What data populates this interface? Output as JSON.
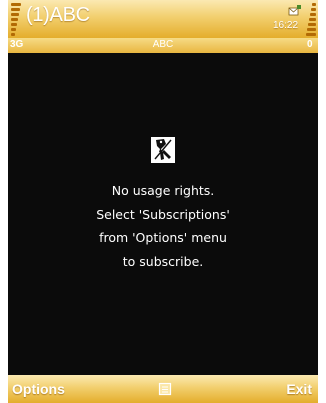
{
  "status_bar": {
    "app_title": "(1)ABC",
    "time": "16:22",
    "message_icon": "envelope-icon",
    "signal_icon": "signal-strength-icon",
    "battery_icon": "battery-level-icon"
  },
  "nav_bar": {
    "network_type": "3G",
    "title": "ABC",
    "indicator": "0"
  },
  "content": {
    "icon": "no-rights-key-icon",
    "message_lines": [
      "No usage rights.",
      "Select 'Subscriptions'",
      "from 'Options' menu",
      "to subscribe."
    ]
  },
  "softkeys": {
    "left_label": "Options",
    "middle_icon": "menu-icon",
    "right_label": "Exit"
  },
  "colors": {
    "bar_light": "#fbe9b2",
    "bar_mid": "#f2cf6e",
    "bar_dark": "#e4ad2c",
    "indicator_brown": "#b26a04",
    "background": "#0b0b0b",
    "text": "#ffffff"
  }
}
